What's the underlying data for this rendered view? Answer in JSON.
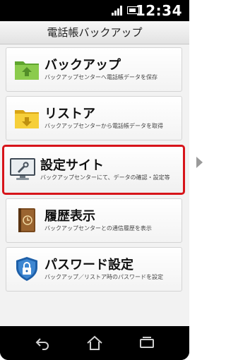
{
  "status_bar": {
    "time": "12:34",
    "signal_icon": "signal-icon",
    "battery_icon": "battery-icon",
    "battery_level": 0.85
  },
  "header": {
    "title": "電話帳バックアップ"
  },
  "menu": {
    "items": [
      {
        "title": "バックアップ",
        "description": "バックアップセンターへ電話帳データを保存",
        "icon": "folder-upload-icon",
        "color": "#7cc242",
        "selected": false
      },
      {
        "title": "リストア",
        "description": "バックアップセンターから電話帳データを取得",
        "icon": "folder-download-icon",
        "color": "#f3c531",
        "selected": false
      },
      {
        "title": "設定サイト",
        "description": "バックアップセンターにて、データの確認・設定等",
        "icon": "settings-monitor-icon",
        "color": "#5f6b75",
        "selected": true
      },
      {
        "title": "履歴表示",
        "description": "バックアップセンターとの通信履歴を表示",
        "icon": "history-book-icon",
        "color": "#8b5a2b",
        "selected": false
      },
      {
        "title": "パスワード設定",
        "description": "バックアップ／リストア時のパスワードを設定",
        "icon": "password-shield-icon",
        "color": "#1d5fa8",
        "selected": false
      }
    ]
  },
  "nav_bar": {
    "back_icon": "back-icon",
    "home_icon": "home-icon",
    "recent_icon": "recent-apps-icon"
  },
  "colors": {
    "selection_border": "#d7141a",
    "screen_background": "#f2f2f2"
  }
}
